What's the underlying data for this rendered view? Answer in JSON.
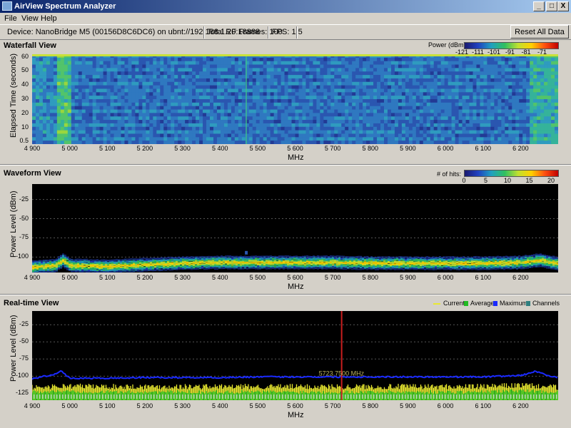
{
  "window": {
    "title": "AirView Spectrum Analyzer",
    "min_symbol": "_",
    "max_symbol": "□",
    "close_symbol": "X"
  },
  "menu": [
    "File",
    "View",
    "Help"
  ],
  "infobar": {
    "device": "Device: NanoBridge M5 (00156D8C6DC6) on ubnt://192.168.1.20:18888",
    "frames": "Total RF Frames: 100",
    "fps": "FPS: 1.5",
    "reset_label": "Reset All Data"
  },
  "colors": {
    "accent_marker": "#c81e1e",
    "current": "#e8e830",
    "average": "#22bb22",
    "maximum": "#1a2aff",
    "channels": "#2f7f7f"
  },
  "x_ticks": [
    "4 900",
    "5 000",
    "5 100",
    "5 200",
    "5 300",
    "5 400",
    "5 500",
    "5 600",
    "5 700",
    "5 800",
    "5 900",
    "6 000",
    "6 100",
    "6 200"
  ],
  "x_axis_label": "MHz",
  "waterfall": {
    "title": "Waterfall View",
    "ylabel": "Elapsed Time (seconds)",
    "y_ticks": [
      "60",
      "50",
      "40",
      "30",
      "20",
      "10",
      "0.5"
    ],
    "legend_title": "Power (dBm):",
    "legend_ticks": [
      "-121",
      "-111",
      "-101",
      "-91",
      "-81",
      "-71"
    ]
  },
  "waveform": {
    "title": "Waveform View",
    "ylabel": "Power Level (dBm)",
    "y_ticks": [
      "-25",
      "-50",
      "-75",
      "-100"
    ],
    "legend_title": "# of hits:",
    "legend_ticks": [
      "0",
      "5",
      "10",
      "15",
      "20"
    ]
  },
  "realtime": {
    "title": "Real-time View",
    "ylabel": "Power Level (dBm)",
    "y_ticks": [
      "-25",
      "-50",
      "-75",
      "-100",
      "-125"
    ],
    "legend": [
      "Current",
      "Average",
      "Maximum",
      "Channels"
    ],
    "marker_label": "5723.7500 MHz"
  },
  "chart_data": [
    {
      "type": "heatmap",
      "title": "Waterfall View",
      "xlabel": "MHz",
      "ylabel": "Elapsed Time (seconds)",
      "xlim": [
        4900,
        6300
      ],
      "ylim": [
        0.5,
        60
      ],
      "colorbar": {
        "label": "Power (dBm):",
        "ticks": [
          -121,
          -111,
          -101,
          -91,
          -81,
          -71
        ]
      }
    },
    {
      "type": "heatmap",
      "title": "Waveform View",
      "xlabel": "MHz",
      "ylabel": "Power Level (dBm)",
      "xlim": [
        4900,
        6300
      ],
      "ylim": [
        -120,
        -5
      ],
      "colorbar": {
        "label": "# of hits:",
        "ticks": [
          0,
          5,
          10,
          15,
          20
        ]
      },
      "band_center": {
        "x": [
          4900,
          4960,
          4980,
          5000,
          5100,
          5200,
          5300,
          5400,
          5500,
          5600,
          5700,
          5800,
          5900,
          6000,
          6100,
          6200,
          6250,
          6300
        ],
        "y": [
          -112,
          -110,
          -103,
          -110,
          -111,
          -109,
          -107,
          -106,
          -106,
          -106,
          -106,
          -107,
          -107,
          -107,
          -107,
          -106,
          -103,
          -108
        ]
      }
    },
    {
      "type": "line",
      "title": "Real-time View",
      "xlabel": "MHz",
      "ylabel": "Power Level (dBm)",
      "xlim": [
        4900,
        6300
      ],
      "ylim": [
        -135,
        -5
      ],
      "marker_mhz": 5723.75,
      "series": [
        {
          "name": "Maximum",
          "x": [
            4900,
            4960,
            4975,
            5000,
            5100,
            5200,
            5300,
            5400,
            5500,
            5600,
            5700,
            5800,
            5900,
            6000,
            6100,
            6200,
            6240,
            6300
          ],
          "y": [
            -104,
            -97,
            -92,
            -103,
            -103,
            -102,
            -102,
            -102,
            -101,
            -101,
            -101,
            -101,
            -101,
            -101,
            -101,
            -99,
            -93,
            -103
          ]
        },
        {
          "name": "Current",
          "x": [
            4900,
            5000,
            5100,
            5200,
            5300,
            5400,
            5500,
            5600,
            5700,
            5800,
            5900,
            6000,
            6100,
            6200,
            6300
          ],
          "y": [
            -117,
            -115,
            -116,
            -116,
            -116,
            -116,
            -116,
            -116,
            -116,
            -116,
            -116,
            -116,
            -116,
            -114,
            -117
          ]
        },
        {
          "name": "Average",
          "x": [
            4900,
            5000,
            5100,
            5200,
            5300,
            5400,
            5500,
            5600,
            5700,
            5800,
            5900,
            6000,
            6100,
            6200,
            6300
          ],
          "y": [
            -123,
            -122,
            -123,
            -123,
            -123,
            -123,
            -123,
            -123,
            -123,
            -123,
            -123,
            -123,
            -123,
            -121,
            -123
          ]
        }
      ]
    }
  ]
}
